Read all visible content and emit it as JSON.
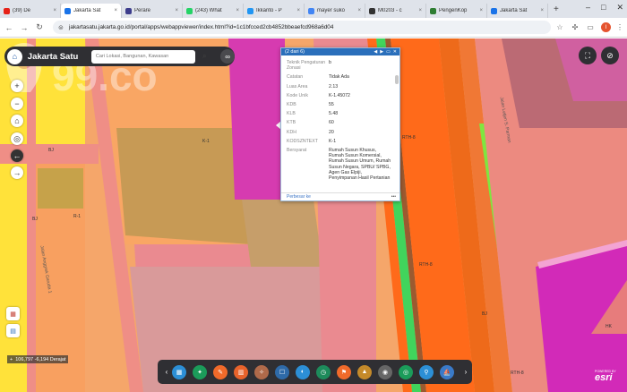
{
  "browser": {
    "tabs": [
      {
        "label": "(39) De",
        "color": "#e62117",
        "active": false,
        "audio": true
      },
      {
        "label": "Jakarta Sat",
        "color": "#1a73e8",
        "active": true
      },
      {
        "label": "Perare",
        "color": "#3c3c8c",
        "active": false
      },
      {
        "label": "(243) What",
        "color": "#25d366",
        "active": false
      },
      {
        "label": "Ikkanto - P",
        "color": "#2196f3",
        "active": false
      },
      {
        "label": "mayer suko",
        "color": "#4285f4",
        "active": false
      },
      {
        "label": "M0203 - c",
        "color": "#333333",
        "active": false
      },
      {
        "label": "PengenKop",
        "color": "#2e7d32",
        "active": false
      },
      {
        "label": "Jakarta Sat",
        "color": "#1a73e8",
        "active": false
      }
    ],
    "new_tab": "+",
    "url": "jakartasatu.jakarta.go.id/portal/apps/webappviewer/index.html?id=1c1bfcced2cb4852bbeaefcd968a6d04",
    "avatar_letter": "I"
  },
  "app": {
    "title": "Jakarta Satu",
    "search_placeholder": "Cari Lokasi, Bangunan, Kawasan"
  },
  "map_labels": {
    "k1_a": "K-1",
    "k1_b": "K-1",
    "r1": "R-1",
    "rth_a": "RTH-8",
    "rth_b": "RTH-8",
    "rth_c": "RTH-8",
    "rth_d": "RTH-8",
    "b1_a": "BJ",
    "b1_b": "BJ",
    "b1_c": "BJ",
    "b1_d": "BJ",
    "b1_e": "BJ",
    "hk": "HK",
    "road_left": "Jalan Anggrek Garuda 1",
    "road_right": "Jalan Letjen S. Parman"
  },
  "popup": {
    "header": "(2 dari 6)",
    "rows": [
      {
        "k": "Teknik Pengaturan Zonasi",
        "v": "b"
      },
      {
        "k": "Catatan",
        "v": "Tidak Ada"
      },
      {
        "k": "Luas Area",
        "v": "2.13"
      },
      {
        "k": "Kode Unik",
        "v": "K-1.45072"
      },
      {
        "k": "KDB",
        "v": "55"
      },
      {
        "k": "KLB",
        "v": "5.48"
      },
      {
        "k": "KTB",
        "v": "60"
      },
      {
        "k": "KDH",
        "v": "20"
      },
      {
        "k": "KODSZNTEXT",
        "v": "K-1"
      },
      {
        "k": "Bersyarat",
        "v": "Rumah Susun Khusus, Rumah Susun Komersial, Rumah Susun Umum, Rumah Susun Negara, SPBU/ SPBG, Agen Gas Elpiji, Penyimpanan Hasil Pertanian"
      }
    ],
    "footer_link": "Perbesar ke",
    "more": "•••"
  },
  "coords": "106,797 -6,194 Derajat",
  "toolbar": {
    "tools": [
      {
        "name": "basemap",
        "color": "#2c8fd6"
      },
      {
        "name": "layers",
        "color": "#1b9c5a"
      },
      {
        "name": "draw",
        "color": "#f06a2a"
      },
      {
        "name": "measure",
        "color": "#e8632b"
      },
      {
        "name": "print",
        "color": "#b06a4a"
      },
      {
        "name": "location",
        "color": "#2e6aa8"
      },
      {
        "name": "share",
        "color": "#2c8fd6"
      },
      {
        "name": "compass",
        "color": "#1d8b5b"
      },
      {
        "name": "bookmark",
        "color": "#f06a2a"
      },
      {
        "name": "analysis",
        "color": "#c58a2a"
      },
      {
        "name": "table",
        "color": "#666666"
      },
      {
        "name": "filter",
        "color": "#1b9c5a"
      },
      {
        "name": "time",
        "color": "#2c8fd6"
      },
      {
        "name": "scene",
        "color": "#3a7ac8"
      }
    ]
  },
  "esri": {
    "powered": "POWERED BY",
    "brand": "esri"
  },
  "watermark": "99.co"
}
